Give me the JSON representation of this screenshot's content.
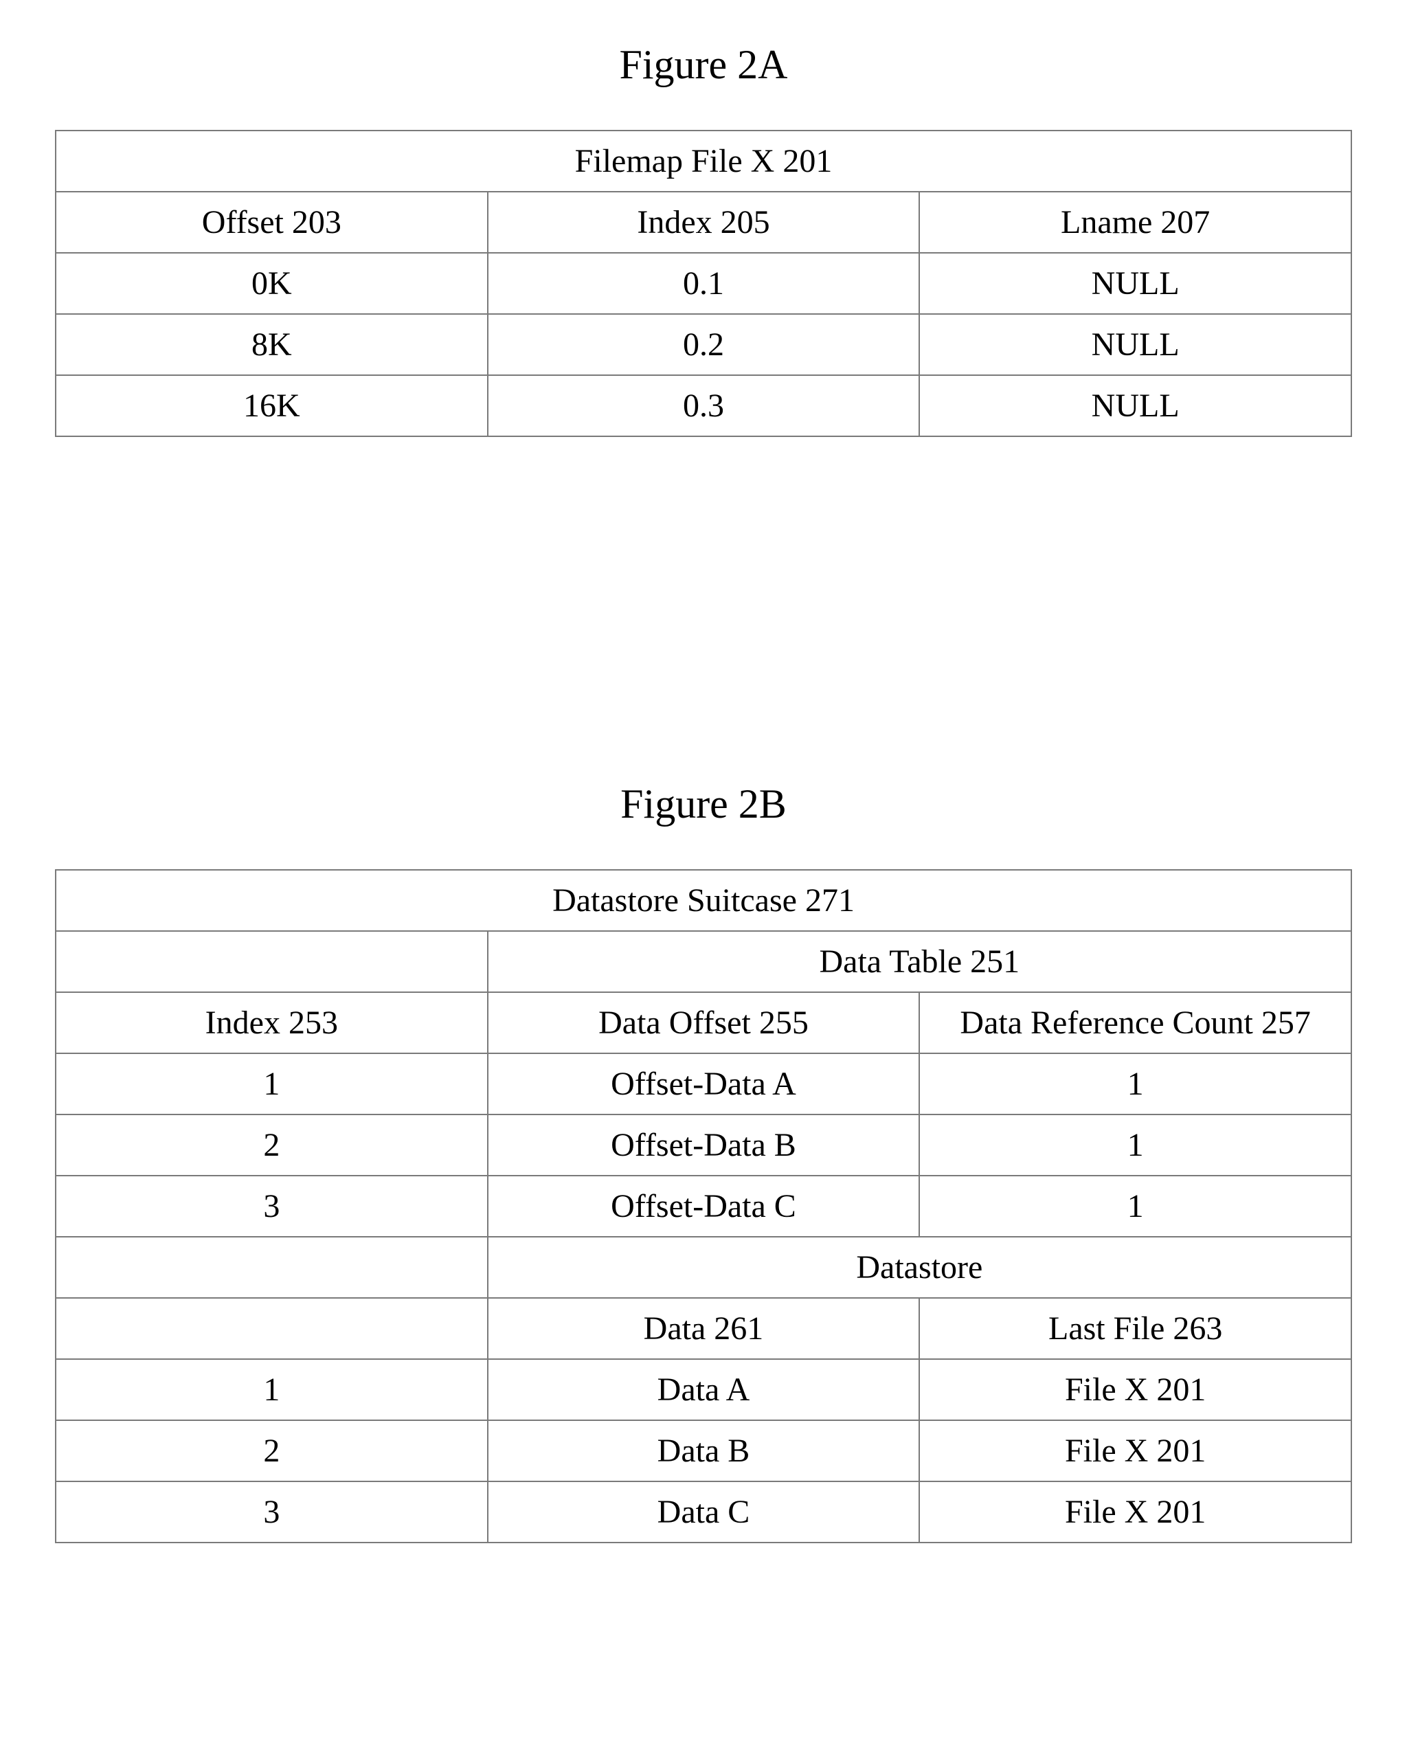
{
  "figureA": {
    "title": "Figure 2A",
    "table": {
      "caption": "Filemap File X 201",
      "headers": [
        "Offset 203",
        "Index 205",
        "Lname 207"
      ],
      "rows": [
        [
          "0K",
          "0.1",
          "NULL"
        ],
        [
          "8K",
          "0.2",
          "NULL"
        ],
        [
          "16K",
          "0.3",
          "NULL"
        ]
      ]
    }
  },
  "figureB": {
    "title": "Figure 2B",
    "table": {
      "caption": "Datastore Suitcase 271",
      "section1": {
        "subcaption": "Data Table 251",
        "headers": [
          "Index 253",
          "Data Offset 255",
          "Data Reference Count 257"
        ],
        "rows": [
          [
            "1",
            "Offset-Data A",
            "1"
          ],
          [
            "2",
            "Offset-Data B",
            "1"
          ],
          [
            "3",
            "Offset-Data C",
            "1"
          ]
        ]
      },
      "section2": {
        "subcaption": "Datastore",
        "headers": [
          "",
          "Data 261",
          "Last File 263"
        ],
        "rows": [
          [
            "1",
            "Data A",
            "File X 201"
          ],
          [
            "2",
            "Data B",
            "File X 201"
          ],
          [
            "3",
            "Data C",
            "File X 201"
          ]
        ]
      }
    }
  }
}
